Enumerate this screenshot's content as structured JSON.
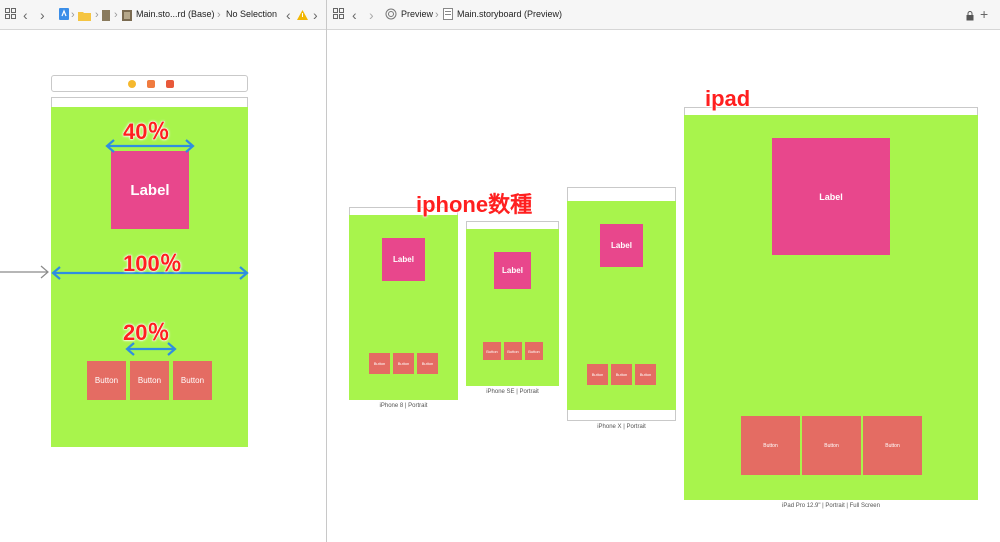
{
  "left_toolbar": {
    "crumb_file": "Main.sto...rd (Base)",
    "crumb_selection": "No Selection"
  },
  "right_toolbar": {
    "crumb_preview": "Preview",
    "crumb_file": "Main.storyboard (Preview)"
  },
  "canvas": {
    "label_text": "Label",
    "button_labels": [
      "Button",
      "Button",
      "Button"
    ]
  },
  "annotations": {
    "width_40": "40％",
    "width_100": "100％",
    "width_20": "20％",
    "iphone_group": "iphone数種",
    "ipad": "ipad"
  },
  "previews": [
    {
      "caption": "iPhone 8 | Portrait",
      "label": "Label",
      "buttons": [
        "Button",
        "Button",
        "Button"
      ]
    },
    {
      "caption": "iPhone SE | Portrait",
      "label": "Label",
      "buttons": [
        "Button",
        "Button",
        "Button"
      ]
    },
    {
      "caption": "iPhone X | Portrait",
      "label": "Label",
      "buttons": [
        "Button",
        "Button",
        "Button"
      ]
    },
    {
      "caption": "iPad Pro 12.9\" | Portrait | Full Screen",
      "label": "Label",
      "buttons": [
        "Button",
        "Button",
        "Button"
      ]
    }
  ],
  "colors": {
    "background_view": "#a8f44c",
    "label_bg": "#e8478c",
    "button_bg": "#e46c63",
    "annotation": "#ff1f1f",
    "arrow": "#2f8ee0"
  }
}
